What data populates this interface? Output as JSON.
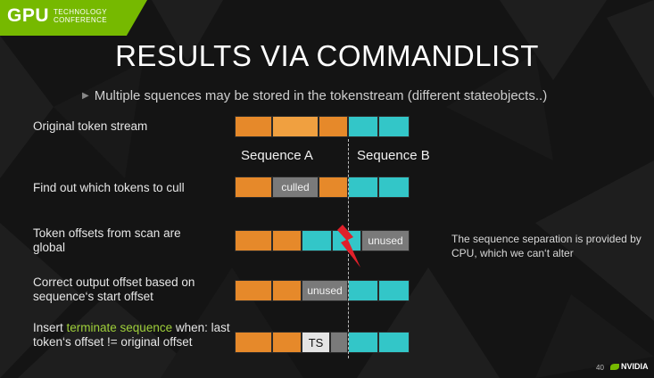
{
  "logo": {
    "main": "GPU",
    "sub1": "TECHNOLOGY",
    "sub2": "CONFERENCE"
  },
  "title": "RESULTS VIA COMMANDLIST",
  "subtitle": "Multiple squences may be stored in the tokenstream (different stateobjects..)",
  "sequences": {
    "a": "Sequence A",
    "b": "Sequence B"
  },
  "rows": [
    {
      "label": "Original token stream"
    },
    {
      "label": "Find out which tokens to cull",
      "culled": "culled"
    },
    {
      "label": "Token offsets from scan are global",
      "unused": "unused"
    },
    {
      "label": "Correct output offset based on sequence‘s start offset",
      "unused": "unused"
    },
    {
      "label_pre": "Insert ",
      "label_hl": "terminate sequence",
      "label_post": " when: last token‘s offset != original offset",
      "ts": "TS"
    }
  ],
  "note": "The sequence separation is provided by CPU, which we can‘t alter",
  "footer": {
    "page": "40",
    "brand": "NVIDIA"
  },
  "colors": {
    "orange": "#e6892a",
    "cyan": "#33c6c8",
    "gray": "#7a7a7a",
    "accent": "#76b900",
    "highlight": "#9fd03a",
    "error": "#e0202a"
  }
}
